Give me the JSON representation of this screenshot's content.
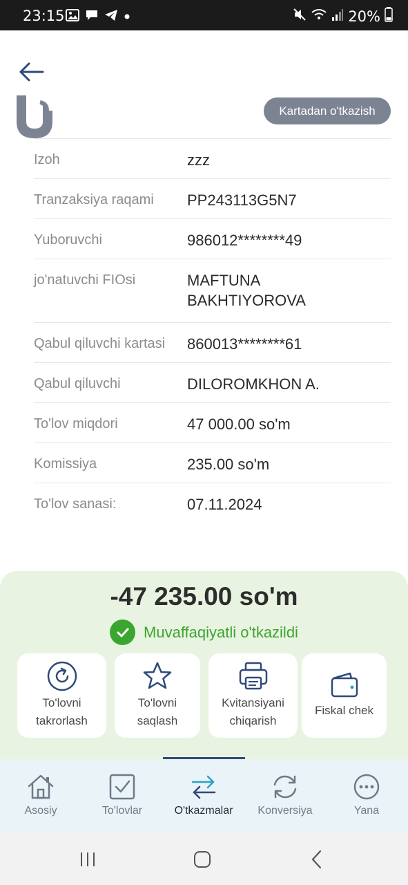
{
  "status_bar": {
    "time": "23:15",
    "battery": "20%",
    "icons_left": [
      "gallery-icon",
      "chat-icon",
      "telegram-icon",
      "dot-icon"
    ],
    "icons_right": [
      "mute-icon",
      "wifi-icon",
      "signal-icon",
      "battery-icon"
    ]
  },
  "header": {
    "type_badge": "Kartadan o'tkazish"
  },
  "details": [
    {
      "label": "Izoh",
      "value": "zzz"
    },
    {
      "label": "Tranzaksiya raqami",
      "value": "PP243113G5N7"
    },
    {
      "label": "Yuboruvchi",
      "value": "986012********49"
    },
    {
      "label": "jo'natuvchi FIOsi",
      "value": "MAFTUNA BAKHTIYOROVA"
    },
    {
      "label": "Qabul qiluvchi kartasi",
      "value": "860013********61"
    },
    {
      "label": "Qabul qiluvchi",
      "value": "DILOROMKHON A."
    },
    {
      "label": "To'lov miqdori",
      "value": "47 000.00 so'm"
    },
    {
      "label": "Komissiya",
      "value": "235.00 so'm"
    },
    {
      "label": "To'lov sanasi:",
      "value": "07.11.2024"
    }
  ],
  "result": {
    "amount": "-47 235.00 so'm",
    "status": "Muvaffaqiyatli o'tkazildi",
    "status_color": "#3aa630"
  },
  "actions": [
    {
      "line1": "To'lovni",
      "line2": "takrorlash",
      "icon": "repeat-icon"
    },
    {
      "line1": "To'lovni",
      "line2": "saqlash",
      "icon": "star-icon"
    },
    {
      "line1": "Kvitansiyani",
      "line2": "chiqarish",
      "icon": "printer-icon"
    },
    {
      "line1": "Fiskal chek",
      "line2": "",
      "icon": "wallet-icon"
    }
  ],
  "bottom_nav": [
    {
      "label": "Asosiy",
      "icon": "home-icon"
    },
    {
      "label": "To'lovlar",
      "icon": "checkbox-icon"
    },
    {
      "label": "O'tkazmalar",
      "icon": "transfer-icon",
      "active": true
    },
    {
      "label": "Konversiya",
      "icon": "conversion-icon"
    },
    {
      "label": "Yana",
      "icon": "more-icon"
    }
  ],
  "colors": {
    "accent_dark": "#2e4a7a",
    "badge": "#7c8494",
    "result_bg": "#e9f3e1",
    "nav_bg": "#eaf3f7"
  }
}
